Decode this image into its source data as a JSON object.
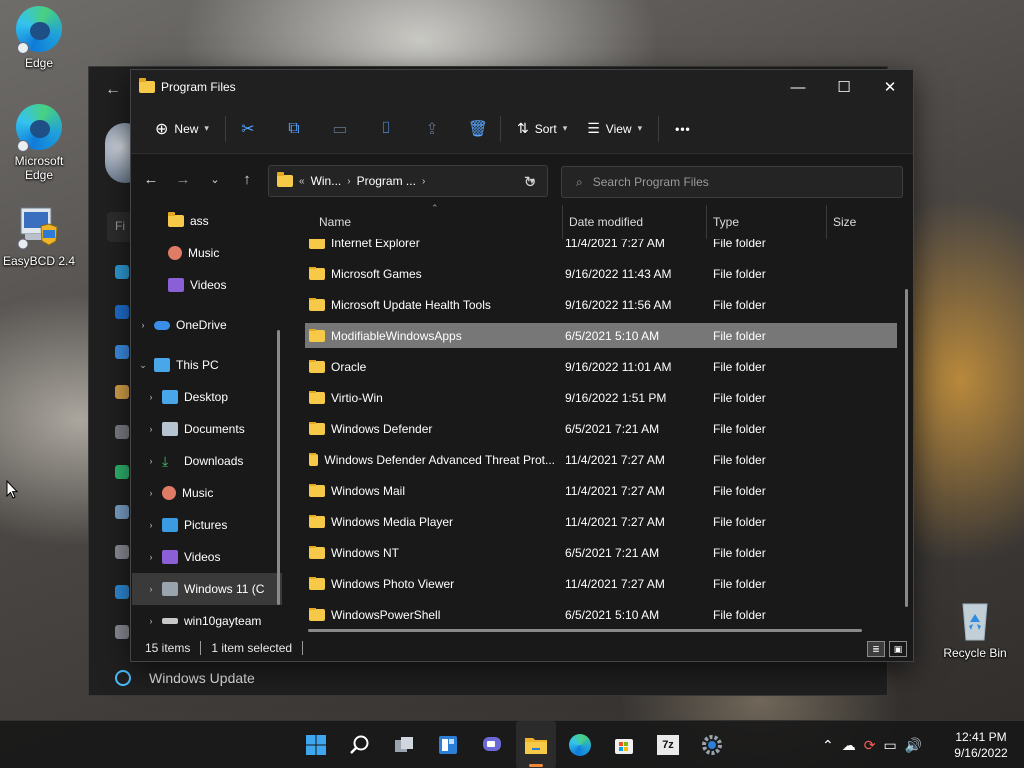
{
  "desktop": {
    "icons": [
      {
        "label": "Edge"
      },
      {
        "label": "Microsoft Edge"
      },
      {
        "label": "EasyBCD 2.4"
      },
      {
        "label": "Recycle Bin"
      }
    ]
  },
  "background_window": {
    "search_partial": "Fi",
    "footer_item": "Windows Update"
  },
  "explorer": {
    "title": "Program Files",
    "toolbar": {
      "new_label": "New",
      "sort_label": "Sort",
      "view_label": "View",
      "more_label": "•••"
    },
    "address": {
      "overflow": "«",
      "crumbs": [
        "Win...",
        "Program ..."
      ]
    },
    "search_placeholder": "Search Program Files",
    "nav": [
      {
        "label": "ass",
        "icon": "folder-icon"
      },
      {
        "label": "Music",
        "icon": "music-icon"
      },
      {
        "label": "Videos",
        "icon": "videos-icon"
      },
      {
        "label": "OneDrive",
        "icon": "cloud-icon"
      },
      {
        "label": "This PC",
        "icon": "computer-icon"
      },
      {
        "label": "Desktop",
        "icon": "desktop-icon"
      },
      {
        "label": "Documents",
        "icon": "documents-icon"
      },
      {
        "label": "Downloads",
        "icon": "download-icon"
      },
      {
        "label": "Music",
        "icon": "music-icon"
      },
      {
        "label": "Pictures",
        "icon": "pictures-icon"
      },
      {
        "label": "Videos",
        "icon": "videos-icon"
      },
      {
        "label": "Windows 11 (C",
        "icon": "drive-icon"
      },
      {
        "label": "win10gayteam",
        "icon": "network-drive-icon"
      }
    ],
    "columns": {
      "name": "Name",
      "date": "Date modified",
      "type": "Type",
      "size": "Size"
    },
    "files": [
      {
        "name": "Internet Explorer",
        "date": "11/4/2021 7:27 AM",
        "type": "File folder"
      },
      {
        "name": "Microsoft Games",
        "date": "9/16/2022 11:43 AM",
        "type": "File folder"
      },
      {
        "name": "Microsoft Update Health Tools",
        "date": "9/16/2022 11:56 AM",
        "type": "File folder"
      },
      {
        "name": "ModifiableWindowsApps",
        "date": "6/5/2021 5:10 AM",
        "type": "File folder"
      },
      {
        "name": "Oracle",
        "date": "9/16/2022 11:01 AM",
        "type": "File folder"
      },
      {
        "name": "Virtio-Win",
        "date": "9/16/2022 1:51 PM",
        "type": "File folder"
      },
      {
        "name": "Windows Defender",
        "date": "6/5/2021 7:21 AM",
        "type": "File folder"
      },
      {
        "name": "Windows Defender Advanced Threat Prot...",
        "date": "11/4/2021 7:27 AM",
        "type": "File folder"
      },
      {
        "name": "Windows Mail",
        "date": "11/4/2021 7:27 AM",
        "type": "File folder"
      },
      {
        "name": "Windows Media Player",
        "date": "11/4/2021 7:27 AM",
        "type": "File folder"
      },
      {
        "name": "Windows NT",
        "date": "6/5/2021 7:21 AM",
        "type": "File folder"
      },
      {
        "name": "Windows Photo Viewer",
        "date": "11/4/2021 7:27 AM",
        "type": "File folder"
      },
      {
        "name": "WindowsPowerShell",
        "date": "6/5/2021 5:10 AM",
        "type": "File folder"
      }
    ],
    "selected_file": "ModifiableWindowsApps",
    "status": {
      "count": "15 items",
      "selection": "1 item selected"
    }
  },
  "taskbar": {
    "apps": [
      "windows-start-icon",
      "search-icon",
      "task-view-icon",
      "widgets-icon",
      "teams-chat-icon",
      "file-explorer-icon",
      "edge-icon",
      "store-icon",
      "7zip-icon",
      "settings-icon"
    ],
    "time": "12:41 PM",
    "date": "9/16/2022"
  },
  "colors": {
    "accent": "#58a6ff",
    "folder": "#f7c948",
    "selection": "#777777"
  }
}
